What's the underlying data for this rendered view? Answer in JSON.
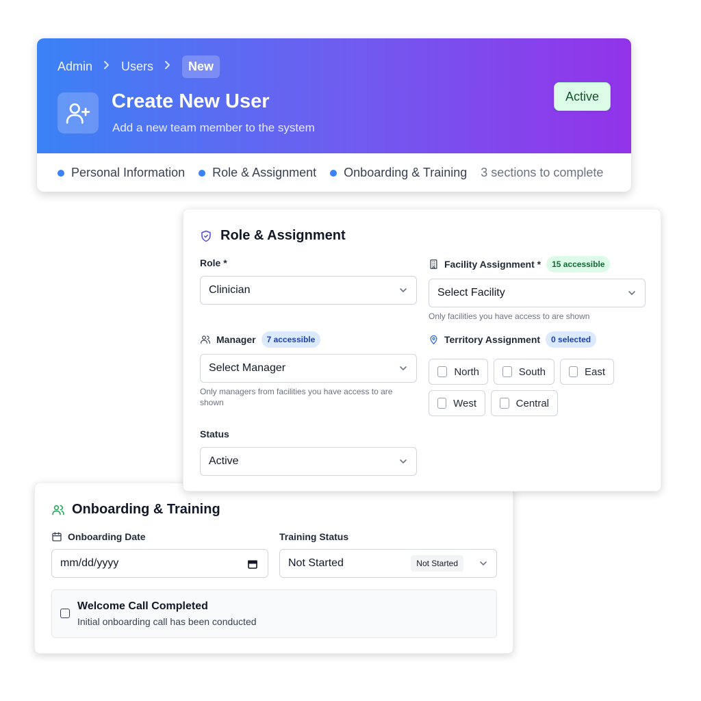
{
  "header": {
    "breadcrumb": [
      "Admin",
      "Users",
      "New"
    ],
    "title": "Create New User",
    "subtitle": "Add a new team member to the system",
    "status": "Active",
    "steps": [
      "Personal Information",
      "Role & Assignment",
      "Onboarding & Training"
    ],
    "steps_remaining": "3 sections to complete"
  },
  "role_section": {
    "title": "Role & Assignment",
    "role_label": "Role *",
    "role_value": "Clinician",
    "facility_label": "Facility Assignment *",
    "facility_badge": "15 accessible",
    "facility_value": "Select Facility",
    "facility_hint": "Only facilities you have access to are shown",
    "manager_label": "Manager",
    "manager_badge": "7 accessible",
    "manager_value": "Select Manager",
    "manager_hint": "Only managers from facilities you have access to are shown",
    "territory_label": "Territory Assignment",
    "territory_badge": "0 selected",
    "territories": [
      "North",
      "South",
      "East",
      "West",
      "Central"
    ],
    "status_label": "Status",
    "status_value": "Active"
  },
  "onboarding_section": {
    "title": "Onboarding & Training",
    "date_label": "Onboarding Date",
    "date_placeholder": "mm/dd/yyyy",
    "training_label": "Training Status",
    "training_value": "Not Started",
    "training_badge": "Not Started",
    "welcome_title": "Welcome Call Completed",
    "welcome_desc": "Initial onboarding call has been conducted"
  },
  "colors": {
    "gradient_start": "#3b82f6",
    "gradient_end": "#9333ea",
    "accent_blue": "#3b82f6",
    "success_green": "#16a34a"
  }
}
